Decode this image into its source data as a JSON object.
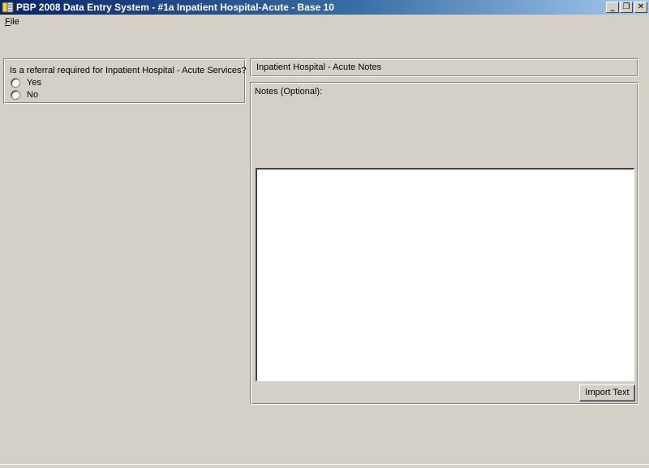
{
  "window": {
    "title": "PBP 2008 Data Entry System - #1a Inpatient Hospital-Acute - Base 10",
    "minimize_glyph": "_",
    "restore_glyph": "❐",
    "close_glyph": "✕"
  },
  "menu": {
    "items": [
      {
        "label": "File"
      }
    ]
  },
  "question": {
    "label": "Is a referral required for Inpatient Hospital - Acute Services?",
    "options": [
      {
        "label": "Yes",
        "selected": false
      },
      {
        "label": "No",
        "selected": false
      }
    ]
  },
  "notes": {
    "header": "Inpatient Hospital - Acute Notes",
    "label": "Notes (Optional):",
    "value": "",
    "import_button": "Import Text"
  },
  "colors": {
    "titlebar_start": "#0a246a",
    "titlebar_end": "#a6caf0",
    "window_bg": "#d4d0c8"
  }
}
